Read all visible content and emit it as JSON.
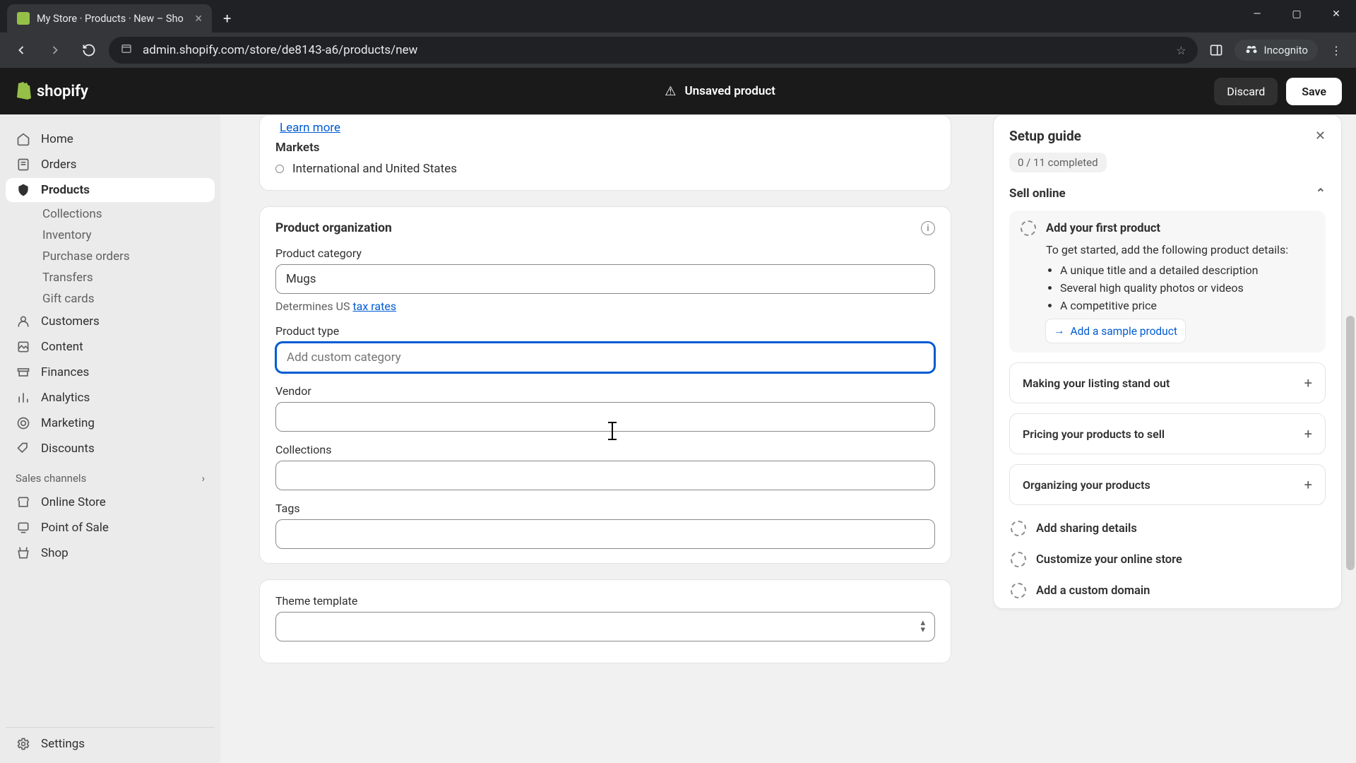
{
  "browser": {
    "tab_title": "My Store · Products · New – Sho",
    "url": "admin.shopify.com/store/de8143-a6/products/new",
    "incognito": "Incognito"
  },
  "topbar": {
    "brand": "shopify",
    "unsaved": "Unsaved product",
    "discard": "Discard",
    "save": "Save"
  },
  "sidebar": {
    "home": "Home",
    "orders": "Orders",
    "products": "Products",
    "collections": "Collections",
    "inventory": "Inventory",
    "purchase_orders": "Purchase orders",
    "transfers": "Transfers",
    "gift_cards": "Gift cards",
    "customers": "Customers",
    "content": "Content",
    "finances": "Finances",
    "analytics": "Analytics",
    "marketing": "Marketing",
    "discounts": "Discounts",
    "sales_channels": "Sales channels",
    "online_store": "Online Store",
    "point_of_sale": "Point of Sale",
    "shop": "Shop",
    "settings": "Settings"
  },
  "markets_card": {
    "learn_more": "Learn more",
    "markets_label": "Markets",
    "markets_value": "International and United States"
  },
  "org": {
    "title": "Product organization",
    "category_label": "Product category",
    "category_value": "Mugs",
    "determines": "Determines US ",
    "tax_rates": "tax rates",
    "type_label": "Product type",
    "type_placeholder": "Add custom category",
    "vendor_label": "Vendor",
    "collections_label": "Collections",
    "tags_label": "Tags"
  },
  "theme": {
    "label": "Theme template"
  },
  "guide": {
    "title": "Setup guide",
    "progress": "0 / 11 completed",
    "sell_online": "Sell online",
    "first_product": "Add your first product",
    "first_body": "To get started, add the following product details:",
    "bullet1": "A unique title and a detailed description",
    "bullet2": "Several high quality photos or videos",
    "bullet3": "A competitive price",
    "sample": "Add a sample product",
    "listing": "Making your listing stand out",
    "pricing": "Pricing your products to sell",
    "organizing": "Organizing your products",
    "sharing": "Add sharing details",
    "customize": "Customize your online store",
    "domain": "Add a custom domain"
  }
}
